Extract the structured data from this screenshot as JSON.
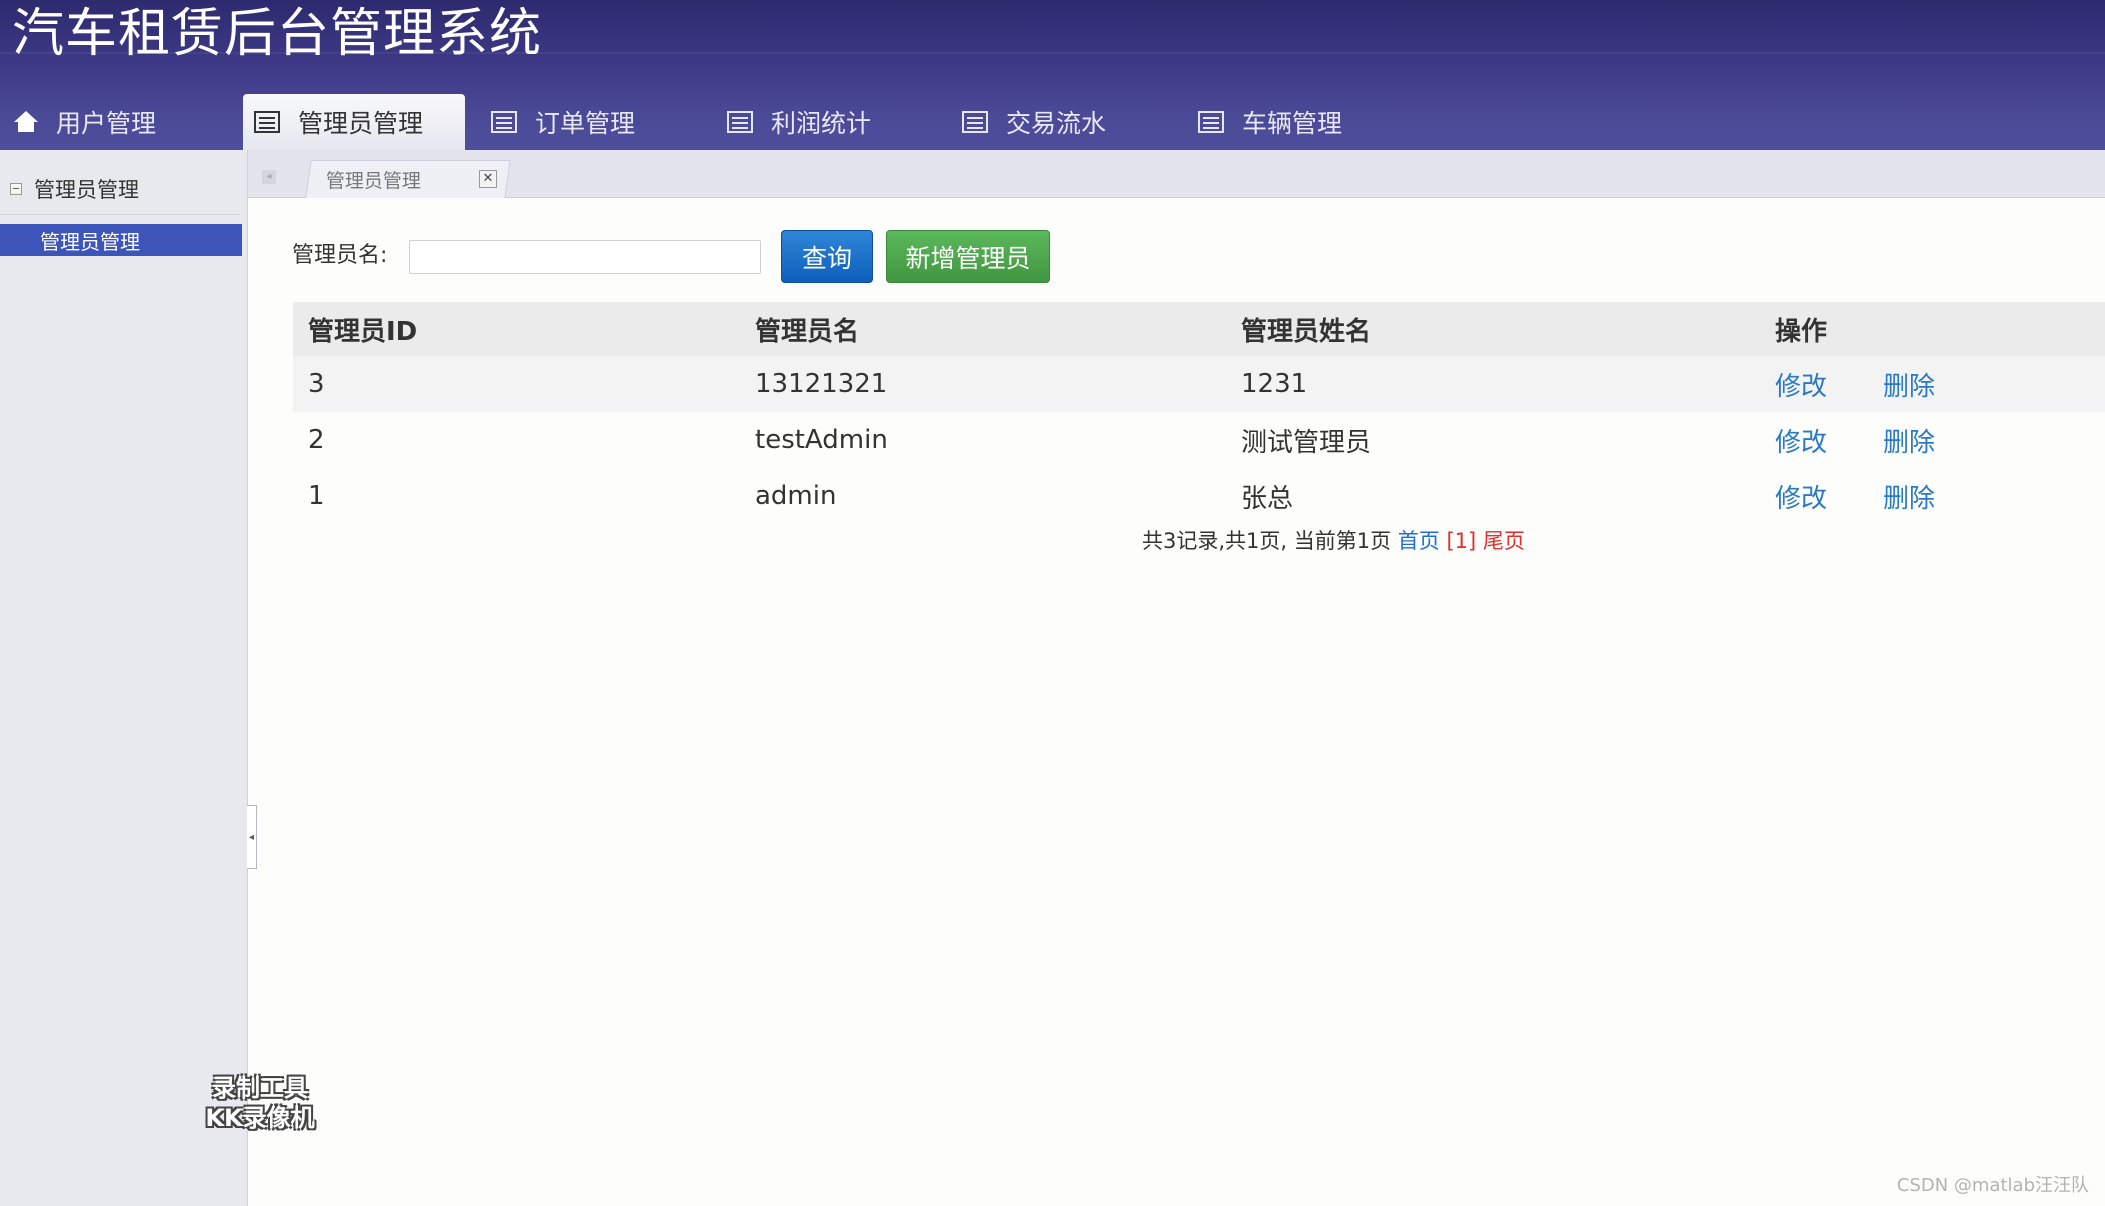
{
  "app": {
    "title": "汽车租赁后台管理系统"
  },
  "nav": {
    "tabs": [
      {
        "label": "用户管理",
        "icon": "home-icon",
        "active": false
      },
      {
        "label": "管理员管理",
        "icon": "list-icon",
        "active": true
      },
      {
        "label": "订单管理",
        "icon": "list-icon",
        "active": false
      },
      {
        "label": "利润统计",
        "icon": "list-icon",
        "active": false
      },
      {
        "label": "交易流水",
        "icon": "list-icon",
        "active": false
      },
      {
        "label": "车辆管理",
        "icon": "list-icon",
        "active": false
      }
    ]
  },
  "sidebar": {
    "group": "管理员管理",
    "items": [
      {
        "label": "管理员管理",
        "selected": true
      }
    ]
  },
  "content_tab": {
    "label": "管理员管理"
  },
  "search": {
    "label": "管理员名:",
    "value": "",
    "query_button": "查询",
    "add_button": "新增管理员"
  },
  "table": {
    "headers": [
      "管理员ID",
      "管理员名",
      "管理员姓名",
      "操作"
    ],
    "rows": [
      {
        "id": "3",
        "username": "13121321",
        "name": "1231",
        "edit": "修改",
        "delete": "删除"
      },
      {
        "id": "2",
        "username": "testAdmin",
        "name": "测试管理员",
        "edit": "修改",
        "delete": "删除"
      },
      {
        "id": "1",
        "username": "admin",
        "name": "张总",
        "edit": "修改",
        "delete": "删除"
      }
    ]
  },
  "pager": {
    "summary": "共3记录,共1页, 当前第1页",
    "first": "首页",
    "current": "[1]",
    "last": "尾页"
  },
  "watermarks": {
    "recorder_line1": "录制工具",
    "recorder_line2": "KK录像机",
    "csdn": "CSDN @matlab汪汪队"
  },
  "colors": {
    "header_bg": "#3e3a88",
    "sidebar_selected": "#3d55b8",
    "query_button": "#1a6fcb",
    "add_button": "#4cae4c",
    "link": "#2a7ac2",
    "pager_current": "#e0302e"
  }
}
